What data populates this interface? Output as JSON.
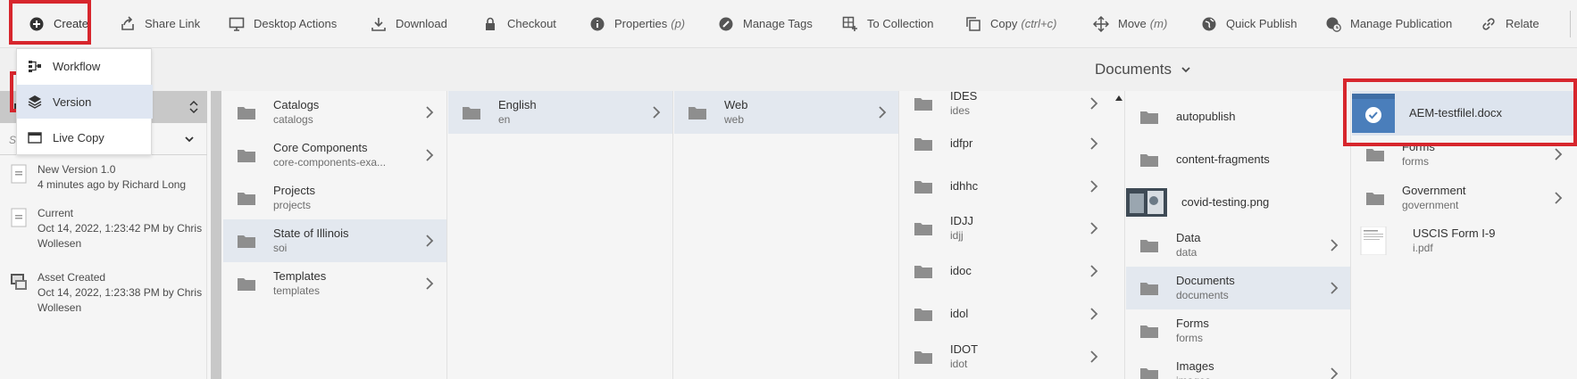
{
  "toolbar": {
    "create": "Create",
    "share_link": "Share Link",
    "desktop_actions": "Desktop Actions",
    "download": "Download",
    "checkout": "Checkout",
    "properties": "Properties",
    "properties_sc": "(p)",
    "manage_tags": "Manage Tags",
    "to_collection": "To Collection",
    "copy": "Copy",
    "copy_sc": "(ctrl+c)",
    "move": "Move",
    "move_sc": "(m)",
    "quick_publish": "Quick Publish",
    "manage_publication": "Manage Publication",
    "relate": "Relate"
  },
  "create_menu": {
    "workflow": "Workflow",
    "version": "Version",
    "live_copy": "Live Copy"
  },
  "header": {
    "title": "Documents"
  },
  "rail": {
    "select_placeholder": "Sh",
    "versions": [
      {
        "line1": "New Version 1.0",
        "line2": "4 minutes ago by Richard Long"
      },
      {
        "line1": "Current",
        "line2": "Oct 14, 2022, 1:23:42 PM by Chris",
        "line3": "Wollesen"
      },
      {
        "line1": "Asset Created",
        "line2": "Oct 14, 2022, 1:23:38 PM by Chris",
        "line3": "Wollesen"
      }
    ]
  },
  "columns": {
    "c1": [
      {
        "title": "Catalogs",
        "sub": "catalogs"
      },
      {
        "title": "Core Components",
        "sub": "core-components-exa..."
      },
      {
        "title": "Projects",
        "sub": "projects"
      },
      {
        "title": "State of Illinois",
        "sub": "soi"
      },
      {
        "title": "Templates",
        "sub": "templates"
      }
    ],
    "c2": [
      {
        "title": "English",
        "sub": "en"
      }
    ],
    "c3": [
      {
        "title": "Web",
        "sub": "web"
      }
    ],
    "c4": [
      {
        "title": "IDES",
        "sub": "ides"
      },
      {
        "title": "idfpr",
        "sub": ""
      },
      {
        "title": "idhhc",
        "sub": ""
      },
      {
        "title": "IDJJ",
        "sub": "idjj"
      },
      {
        "title": "idoc",
        "sub": ""
      },
      {
        "title": "idol",
        "sub": ""
      },
      {
        "title": "IDOT",
        "sub": "idot"
      }
    ],
    "c5": [
      {
        "title": "autopublish",
        "sub": ""
      },
      {
        "title": "content-fragments",
        "sub": ""
      },
      {
        "title": "covid-testing.png",
        "sub": ""
      },
      {
        "title": "Data",
        "sub": "data"
      },
      {
        "title": "Documents",
        "sub": "documents"
      },
      {
        "title": "Forms",
        "sub": "forms"
      },
      {
        "title": "Images",
        "sub": "images"
      }
    ],
    "c6": [
      {
        "title": "AEM-testfilel.docx",
        "sub": ""
      },
      {
        "title": "Forms",
        "sub": "forms"
      },
      {
        "title": "Government",
        "sub": "government"
      },
      {
        "title": "USCIS Form I-9",
        "sub": "i.pdf"
      }
    ]
  },
  "colors": {
    "highlight": "#d7262d",
    "selected_row": "#e3e8ef",
    "menu_selected": "#dfe6f2",
    "check_blue": "#4a7ebb"
  }
}
